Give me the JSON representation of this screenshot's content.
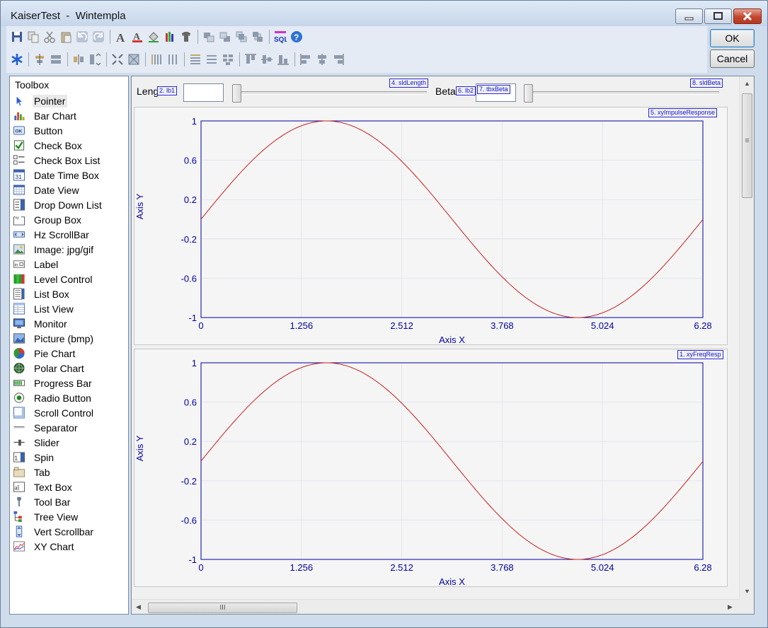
{
  "window": {
    "title": "KaiserTest  -  Wintempla"
  },
  "dialog_buttons": {
    "ok": "OK",
    "cancel": "Cancel"
  },
  "toolbar_icons": {
    "row1": [
      "save-icon",
      "copy-icon",
      "cut-icon",
      "paste-icon",
      "undo-icon",
      "redo-icon",
      "sep",
      "font-icon",
      "font-color-icon",
      "fill-color-icon",
      "pencils-icon",
      "shirt-icon",
      "sep",
      "bring-forward-icon",
      "send-backward-icon",
      "bring-front-icon",
      "send-back-icon",
      "sep",
      "sql-icon",
      "help-icon"
    ],
    "row2": [
      "tab-order-icon",
      "sep",
      "center-horizontal-icon",
      "center-vertical-icon",
      "sep",
      "space-horizontal-icon",
      "space-vertical-icon",
      "sep",
      "shrink-icon",
      "expand-icon",
      "sep",
      "columns-icon",
      "columns-narrow-icon",
      "sep",
      "rows-icon",
      "rows-narrow-icon",
      "grid-icon",
      "sep",
      "align-top-icon",
      "align-middle-icon",
      "align-bottom-icon",
      "sep",
      "align-left-icon",
      "align-center-icon",
      "align-right-icon"
    ]
  },
  "toolbox": {
    "title": "Toolbox",
    "items": [
      {
        "label": "Pointer",
        "icon": "pointer-icon",
        "selected": true
      },
      {
        "label": "Bar Chart",
        "icon": "bar-chart-icon"
      },
      {
        "label": "Button",
        "icon": "button-icon"
      },
      {
        "label": "Check Box",
        "icon": "check-box-icon"
      },
      {
        "label": "Check Box List",
        "icon": "check-box-list-icon"
      },
      {
        "label": "Date Time Box",
        "icon": "date-time-box-icon"
      },
      {
        "label": "Date View",
        "icon": "date-view-icon"
      },
      {
        "label": "Drop Down List",
        "icon": "drop-down-list-icon"
      },
      {
        "label": "Group Box",
        "icon": "group-box-icon"
      },
      {
        "label": "Hz ScrollBar",
        "icon": "hz-scrollbar-icon"
      },
      {
        "label": "Image: jpg/gif",
        "icon": "image-icon"
      },
      {
        "label": "Label",
        "icon": "label-icon"
      },
      {
        "label": "Level Control",
        "icon": "level-control-icon"
      },
      {
        "label": "List Box",
        "icon": "list-box-icon"
      },
      {
        "label": "List View",
        "icon": "list-view-icon"
      },
      {
        "label": "Monitor",
        "icon": "monitor-icon"
      },
      {
        "label": "Picture (bmp)",
        "icon": "picture-icon"
      },
      {
        "label": "Pie Chart",
        "icon": "pie-chart-icon"
      },
      {
        "label": "Polar Chart",
        "icon": "polar-chart-icon"
      },
      {
        "label": "Progress Bar",
        "icon": "progress-bar-icon"
      },
      {
        "label": "Radio Button",
        "icon": "radio-button-icon"
      },
      {
        "label": "Scroll Control",
        "icon": "scroll-control-icon"
      },
      {
        "label": "Separator",
        "icon": "separator-icon"
      },
      {
        "label": "Slider",
        "icon": "slider-icon"
      },
      {
        "label": "Spin",
        "icon": "spin-icon"
      },
      {
        "label": "Tab",
        "icon": "tab-icon"
      },
      {
        "label": "Text Box",
        "icon": "text-box-icon"
      },
      {
        "label": "Tool Bar",
        "icon": "tool-bar-icon"
      },
      {
        "label": "Tree View",
        "icon": "tree-view-icon"
      },
      {
        "label": "Vert Scrollbar",
        "icon": "vert-scrollbar-icon"
      },
      {
        "label": "XY Chart",
        "icon": "xy-chart-icon"
      }
    ]
  },
  "designer": {
    "length_label": "Leng",
    "beta_label": "Beta",
    "length_value": "",
    "beta_value": "",
    "slider_length_value": 0,
    "slider_beta_value": 0,
    "tags": {
      "lb1": "2. lb1",
      "sldLength": "4. sldLength",
      "lb2": "6. lb2",
      "tbxBeta": "7. tbxBeta",
      "sldBeta": "8. sldBeta",
      "xyImpulseResponse": "5. xyImpulseResponse",
      "xyFreqResp": "1. xyFreqResp"
    },
    "hscroll_thumb_glyph": "III",
    "vscroll_thumb_glyph": "≡"
  },
  "colors": {
    "axis": "#0000a0",
    "curve": "#c81e1e",
    "grid": "#e4e4ee",
    "plot_bg": "#f5f5f5"
  },
  "chart_data": [
    {
      "type": "line",
      "title": "",
      "xlabel": "Axis X",
      "ylabel": "Axis Y",
      "xlim": [
        0,
        6.28
      ],
      "ylim": [
        -1,
        1
      ],
      "xticks": [
        0,
        1.256,
        2.512,
        3.768,
        5.024,
        6.28
      ],
      "yticks": [
        1,
        0.6,
        0.2,
        -0.2,
        -0.6,
        -1
      ],
      "grid": true,
      "series": [
        {
          "function": "sin",
          "x_start": 0,
          "x_end": 6.28
        }
      ]
    },
    {
      "type": "line",
      "title": "",
      "xlabel": "Axis X",
      "ylabel": "Axis Y",
      "xlim": [
        0,
        6.28
      ],
      "ylim": [
        -1,
        1
      ],
      "xticks": [
        0,
        1.256,
        2.512,
        3.768,
        5.024,
        6.28
      ],
      "yticks": [
        1,
        0.6,
        0.2,
        -0.2,
        -0.6,
        -1
      ],
      "grid": true,
      "series": [
        {
          "function": "sin",
          "x_start": 0,
          "x_end": 6.28
        }
      ]
    }
  ]
}
